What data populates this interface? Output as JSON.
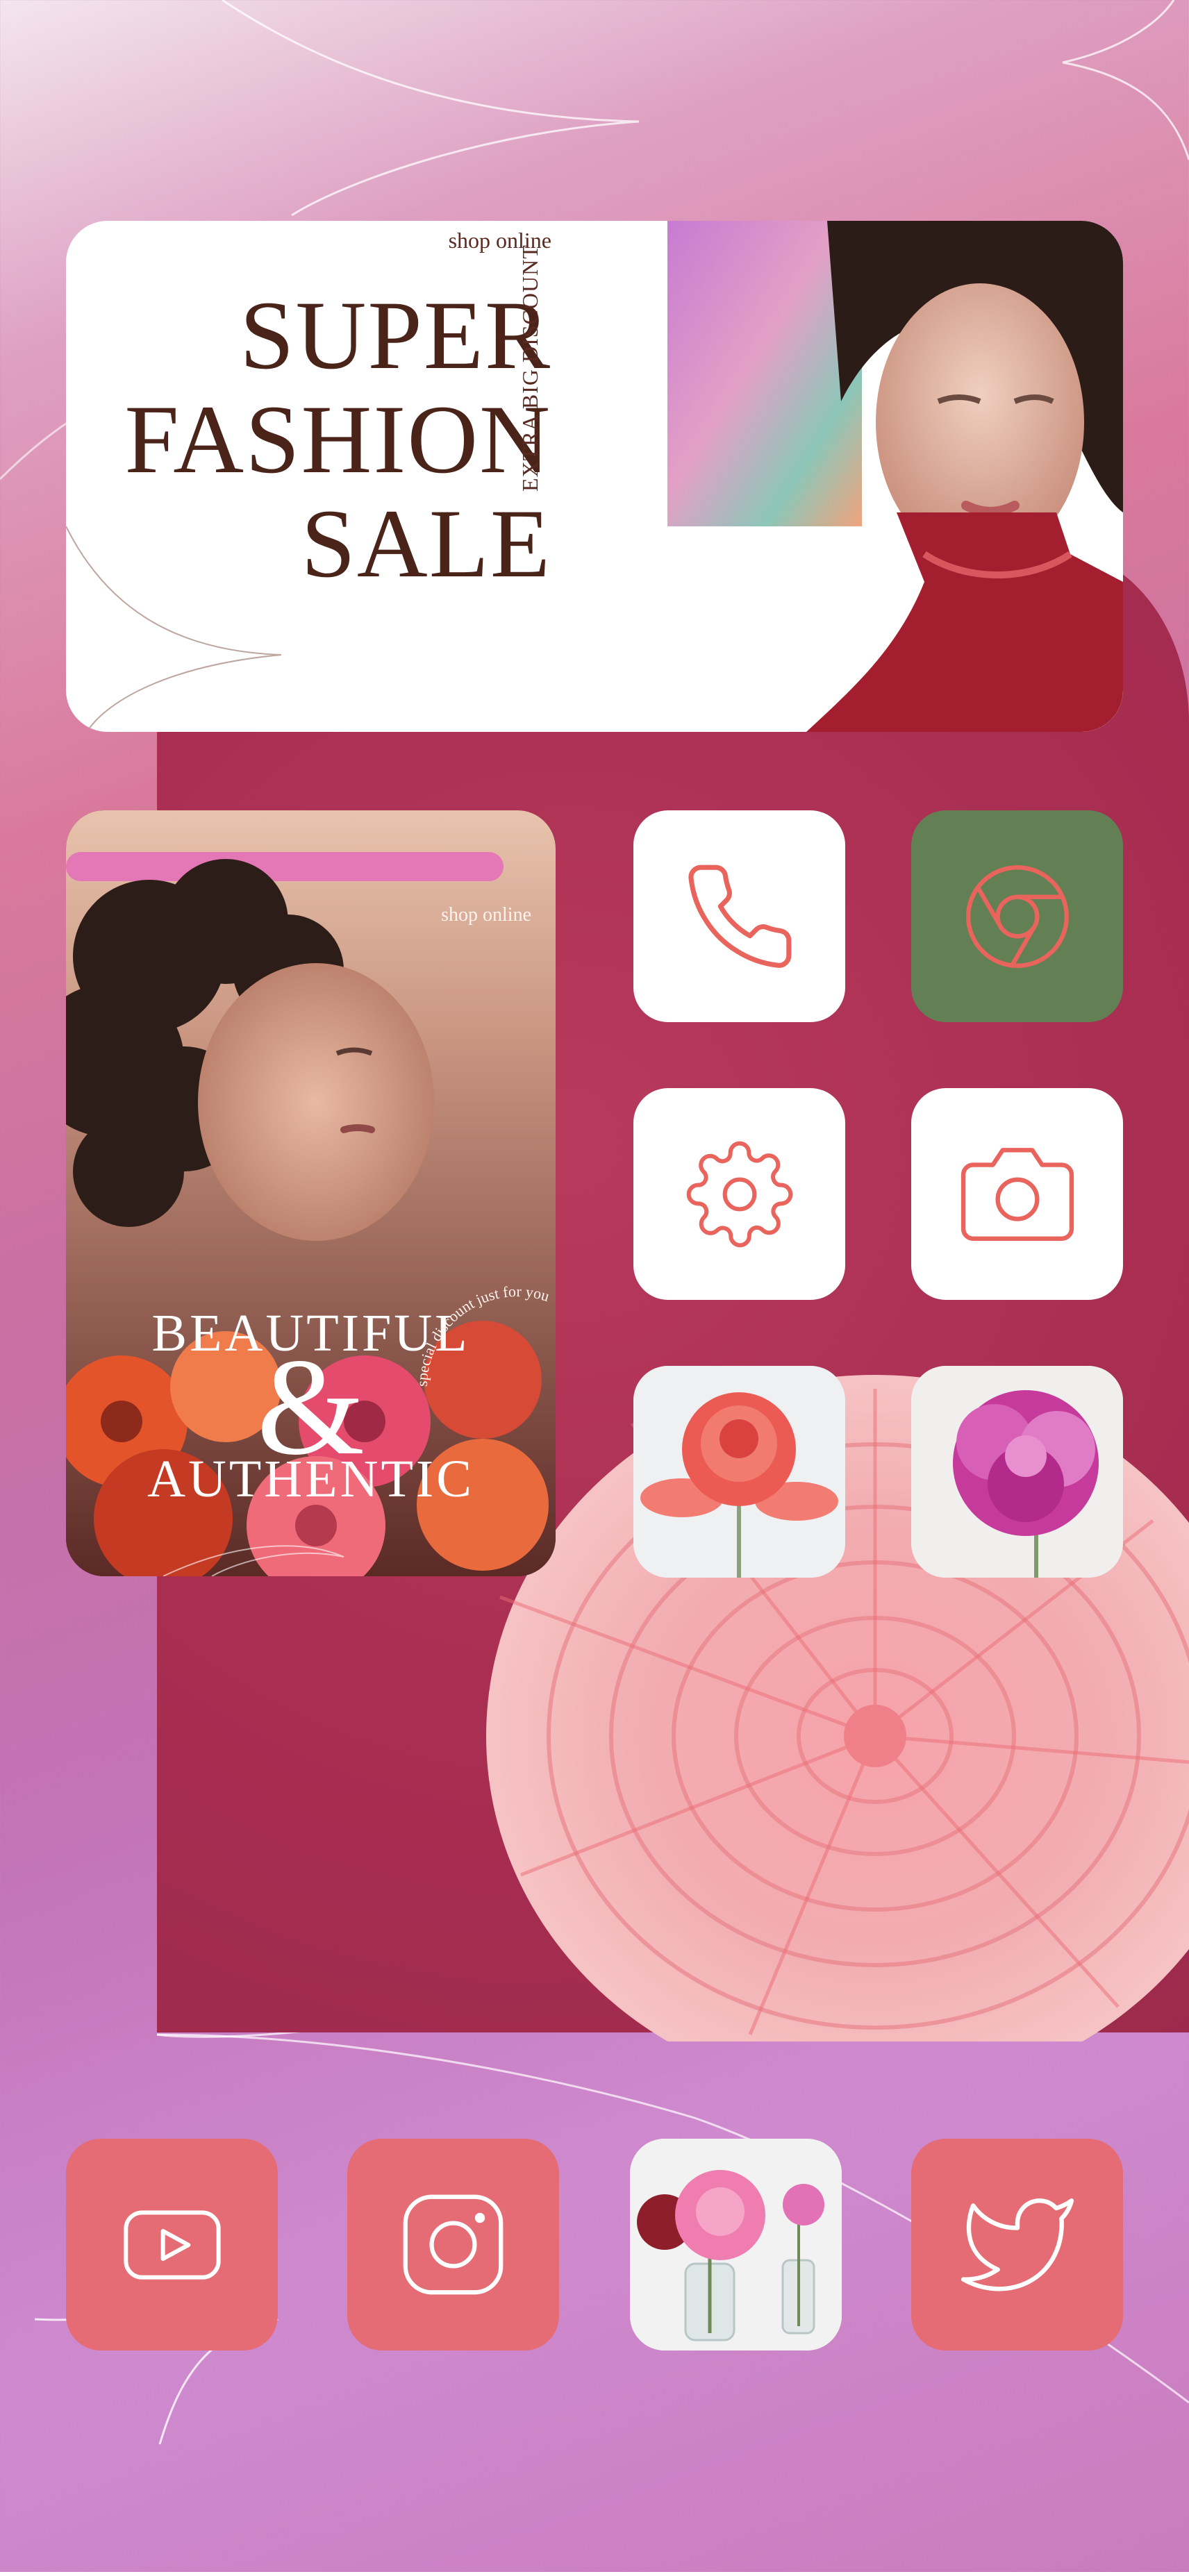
{
  "colors": {
    "maroon": "#a72d51",
    "coral_icon": "#e56c74",
    "green_icon": "#637f54",
    "stroke_accent": "#e8645c",
    "banner_text": "#4a2319"
  },
  "banner": {
    "shop_label": "shop online",
    "headline": [
      "SUPER",
      "FASHION",
      "SALE"
    ],
    "side_text": "EXTRA BIG DISCOUNT"
  },
  "widget": {
    "shop_label": "shop online",
    "title_top": "BEAUTIFUL",
    "ampersand": "&",
    "title_bottom": "AUTHENTIC",
    "arc_text": "special discount just for you"
  },
  "apps_grid": [
    {
      "name": "phone",
      "icon": "phone-icon"
    },
    {
      "name": "chrome",
      "icon": "chrome-icon"
    },
    {
      "name": "settings",
      "icon": "gear-icon"
    },
    {
      "name": "camera",
      "icon": "camera-icon"
    },
    {
      "name": "rose-photo",
      "icon": "photo"
    },
    {
      "name": "peony-photo",
      "icon": "photo"
    }
  ],
  "dock": [
    {
      "name": "youtube",
      "icon": "youtube-icon"
    },
    {
      "name": "instagram",
      "icon": "instagram-icon"
    },
    {
      "name": "flowers-photo",
      "icon": "photo"
    },
    {
      "name": "twitter",
      "icon": "twitter-icon"
    }
  ]
}
